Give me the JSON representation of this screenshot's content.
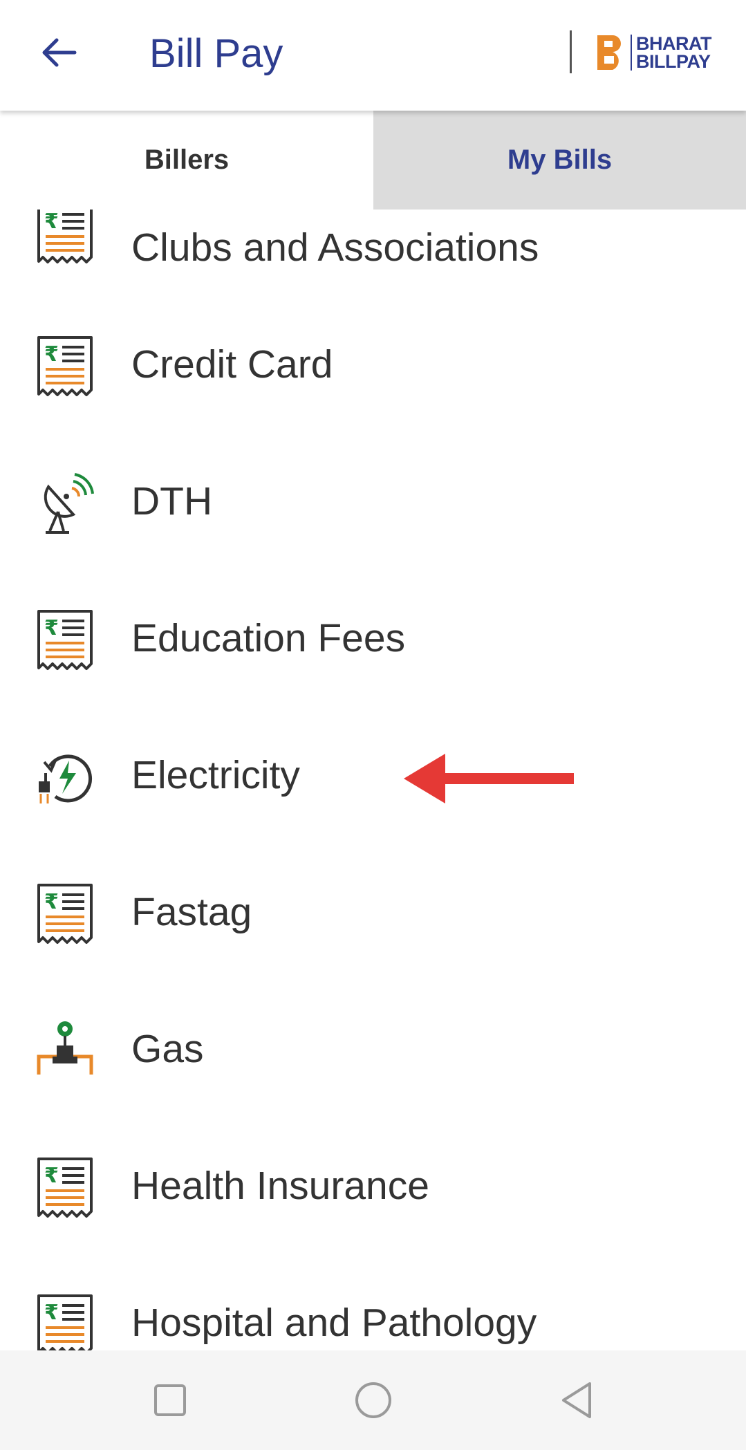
{
  "header": {
    "title": "Bill Pay",
    "brand_line1": "BHARAT",
    "brand_line2": "BILLPAY"
  },
  "tabs": [
    {
      "label": "Billers",
      "selected": true
    },
    {
      "label": "My Bills",
      "selected": false
    }
  ],
  "billers": [
    {
      "label": "Clubs and Associations",
      "icon": "receipt-icon"
    },
    {
      "label": "Credit Card",
      "icon": "receipt-icon"
    },
    {
      "label": "DTH",
      "icon": "satellite-dish-icon"
    },
    {
      "label": "Education Fees",
      "icon": "receipt-icon"
    },
    {
      "label": "Electricity",
      "icon": "electricity-plug-icon"
    },
    {
      "label": "Fastag",
      "icon": "receipt-icon"
    },
    {
      "label": "Gas",
      "icon": "gas-pipeline-icon"
    },
    {
      "label": "Health Insurance",
      "icon": "receipt-icon"
    },
    {
      "label": "Hospital and Pathology",
      "icon": "receipt-icon"
    }
  ],
  "colors": {
    "primary": "#2e3d8f",
    "accent_orange": "#e8892a",
    "accent_green": "#1e8a3c",
    "annotation_arrow": "#e53935",
    "tab_inactive_bg": "#dcdcdc"
  },
  "annotation": {
    "icon": "red-arrow-pointer",
    "points_to": "Electricity"
  },
  "system_nav": {
    "icons": [
      "square-recent-apps-icon",
      "circle-home-icon",
      "triangle-back-icon"
    ]
  }
}
